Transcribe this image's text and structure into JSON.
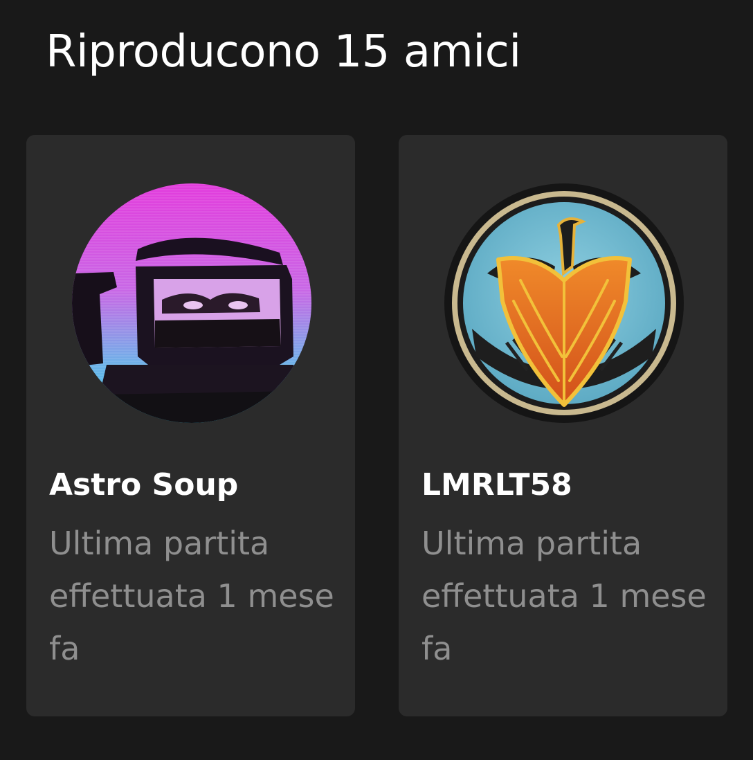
{
  "header": {
    "title": "Riproducono 15 amici"
  },
  "friends": [
    {
      "name": "Astro Soup",
      "status": "Ultima partita effettuata 1 mese fa",
      "avatar_icon": "astronaut-helmet-avatar"
    },
    {
      "name": "LMRLT58",
      "status": "Ultima partita effettuata 1 mese fa",
      "avatar_icon": "phoenix-shield-emblem-avatar"
    }
  ],
  "colors": {
    "background": "#191919",
    "card": "#2b2b2b",
    "name": "#ffffff",
    "status": "#8f8f8f"
  }
}
